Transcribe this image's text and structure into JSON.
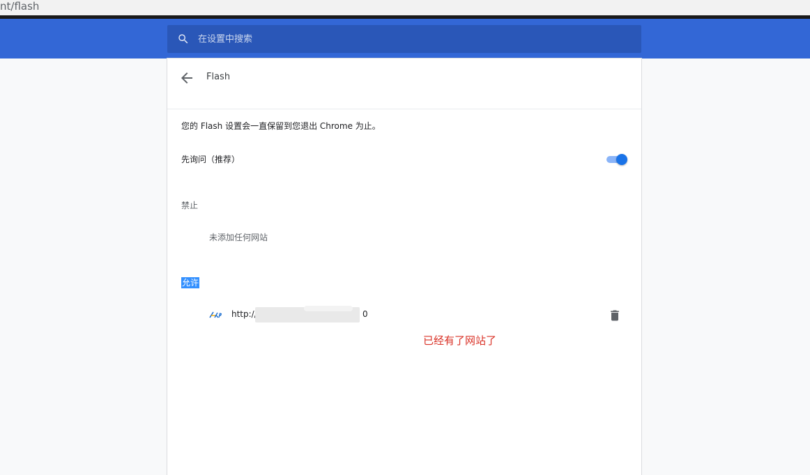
{
  "address_bar": {
    "url_fragment": "nt/flash"
  },
  "search": {
    "placeholder": "在设置中搜索",
    "icon": "search-icon"
  },
  "header": {
    "back_icon": "arrow-back-icon",
    "title": "Flash"
  },
  "content": {
    "description": "您的 Flash 设置会一直保留到您退出 Chrome 为止。",
    "ask_label": "先询问（推荐）",
    "ask_toggle": {
      "state": "on",
      "accent_color": "#1a73e8"
    },
    "block": {
      "heading": "禁止",
      "empty_text": "未添加任何网站"
    },
    "allow": {
      "heading": "允许",
      "sites": [
        {
          "favicon": "ekp-logo-icon",
          "url_start": "http://",
          "url_end": "0",
          "delete_icon": "trash-icon"
        }
      ]
    }
  },
  "annotation": {
    "text": "已经有了网站了",
    "color": "#d93025"
  },
  "colors": {
    "toolbar": "#3367d6",
    "search_box": "#2a57b8",
    "selection": "#3390ff"
  }
}
